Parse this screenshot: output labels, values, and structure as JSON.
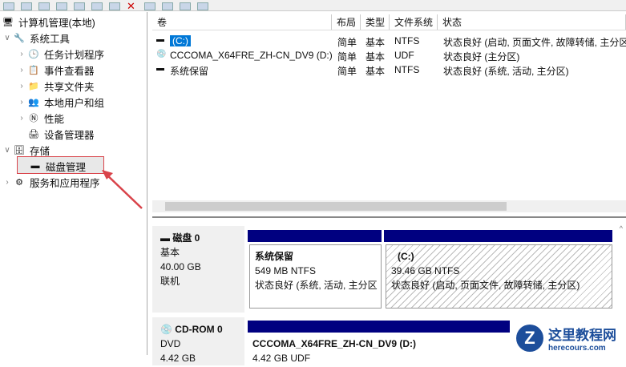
{
  "tree": {
    "root": "计算机管理(本地)",
    "system_tools": "系统工具",
    "task_scheduler": "任务计划程序",
    "event_viewer": "事件查看器",
    "shared_folders": "共享文件夹",
    "local_users": "本地用户和组",
    "performance": "性能",
    "device_manager": "设备管理器",
    "storage": "存储",
    "disk_management": "磁盘管理",
    "services_apps": "服务和应用程序"
  },
  "list": {
    "columns": [
      "卷",
      "布局",
      "类型",
      "文件系统",
      "状态"
    ],
    "rows": [
      {
        "volume": "(C:)",
        "layout": "简单",
        "type": "基本",
        "fs": "NTFS",
        "status": "状态良好 (启动, 页面文件, 故障转储, 主分区)"
      },
      {
        "volume": "CCCOMA_X64FRE_ZH-CN_DV9 (D:)",
        "layout": "简单",
        "type": "基本",
        "fs": "UDF",
        "status": "状态良好 (主分区)"
      },
      {
        "volume": "系统保留",
        "layout": "简单",
        "type": "基本",
        "fs": "NTFS",
        "status": "状态良好 (系统, 活动, 主分区)"
      }
    ]
  },
  "disks": [
    {
      "name": "磁盘 0",
      "kind": "基本",
      "size": "40.00 GB",
      "state": "联机",
      "parts": [
        {
          "name": "系统保留",
          "size": "549 MB NTFS",
          "status": "状态良好 (系统, 活动, 主分区"
        },
        {
          "name": "(C:)",
          "size": "39.46 GB NTFS",
          "status": "状态良好 (启动, 页面文件, 故障转储, 主分区)"
        }
      ]
    },
    {
      "name": "CD-ROM 0",
      "kind": "DVD",
      "size": "4.42 GB",
      "parts": [
        {
          "name": "CCCOMA_X64FRE_ZH-CN_DV9  (D:)",
          "size": "4.42 GB UDF"
        }
      ]
    }
  ],
  "watermark": {
    "title": "这里教程网",
    "url": "herecours.com"
  },
  "colors": {
    "partition_bar": "#000080",
    "highlight": "#d9434a",
    "selection": "#0078d7"
  }
}
